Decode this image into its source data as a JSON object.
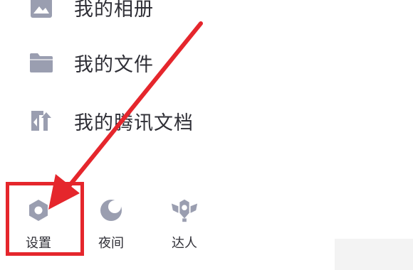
{
  "menu": {
    "items": [
      {
        "label": "我的相册",
        "icon": "photo-icon"
      },
      {
        "label": "我的文件",
        "icon": "folder-icon"
      },
      {
        "label": "我的腾讯文档",
        "icon": "tencent-docs-icon"
      }
    ]
  },
  "bottom_bar": {
    "items": [
      {
        "label": "设置",
        "icon": "settings-icon"
      },
      {
        "label": "夜间",
        "icon": "moon-icon"
      },
      {
        "label": "达人",
        "icon": "badge-icon"
      }
    ]
  },
  "colors": {
    "icon": "#9a9eb0",
    "text": "#2f2f36",
    "annotation": "#e5262c"
  }
}
